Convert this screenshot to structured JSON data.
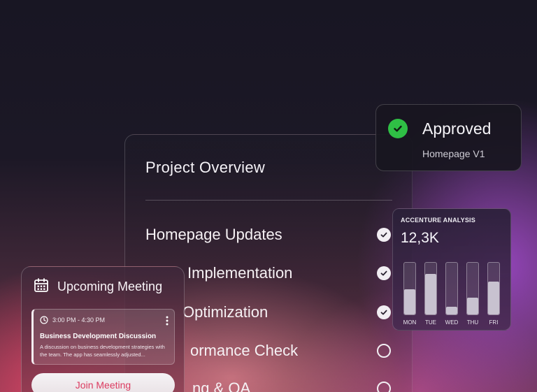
{
  "overview": {
    "title": "Project Overview",
    "tasks": [
      {
        "label": "Homepage Updates",
        "done": true
      },
      {
        "label": "Implementation",
        "done": true
      },
      {
        "label": "Optimization",
        "done": true
      },
      {
        "label": "ormance Check",
        "done": false
      },
      {
        "label": "ng & QA",
        "done": false
      }
    ]
  },
  "approved": {
    "title": "Approved",
    "subtitle": "Homepage V1",
    "icon": "check-circle-icon",
    "color": "#2fbf45"
  },
  "analysis": {
    "title": "ACCENTURE ANALYSIS",
    "value": "12,3K",
    "chart_data": {
      "type": "bar",
      "categories": [
        "MON",
        "TUE",
        "WED",
        "THU",
        "FRI"
      ],
      "values": [
        0.49,
        0.78,
        0.15,
        0.32,
        0.64
      ],
      "ylim": [
        0,
        1
      ],
      "grid": false
    }
  },
  "meeting": {
    "title": "Upcoming Meeting",
    "icon": "calendar-icon",
    "event": {
      "time": "3:00 PM - 4:30 PM",
      "title": "Business Development Discussion",
      "description": "A discussion on business development strategies with the team. The app has seamlessly adjusted..."
    },
    "join_label": "Join Meeting",
    "join_color": "#dc3b60"
  }
}
